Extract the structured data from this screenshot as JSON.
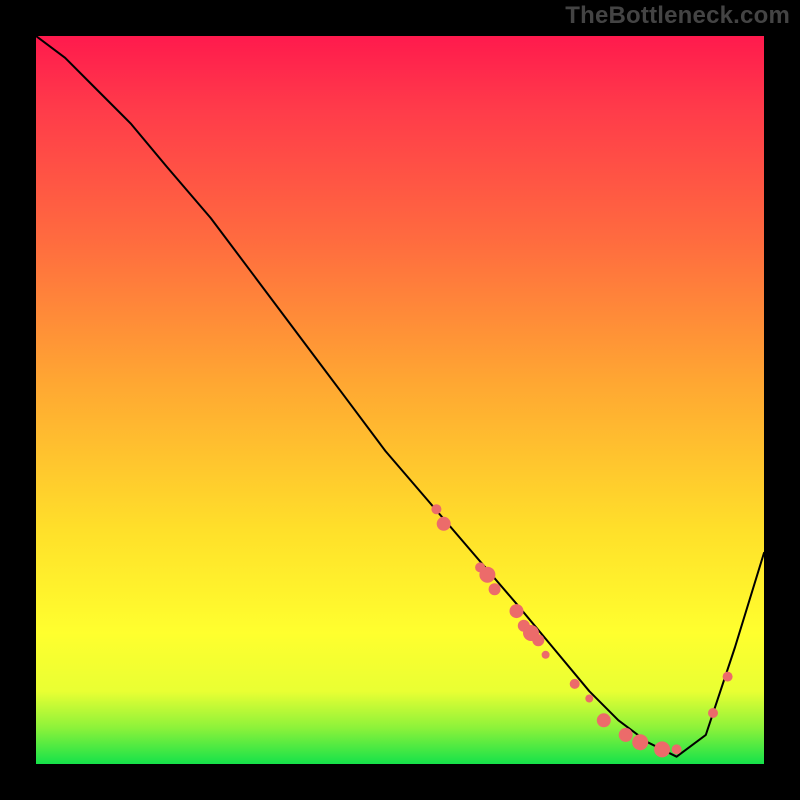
{
  "watermark": "TheBottleneck.com",
  "colors": {
    "background": "#000000",
    "gradient_top": "#ff1a4d",
    "gradient_mid": "#ffe02a",
    "gradient_bottom": "#15e24a",
    "curve": "#000000",
    "points": "#ec6b6a"
  },
  "chart_data": {
    "type": "line",
    "title": "",
    "xlabel": "",
    "ylabel": "",
    "xlim": [
      0,
      100
    ],
    "ylim": [
      0,
      100
    ],
    "grid": false,
    "legend": false,
    "annotations": [],
    "series": [
      {
        "name": "curve",
        "x": [
          0,
          4,
          8,
          13,
          18,
          24,
          30,
          36,
          42,
          48,
          54,
          60,
          66,
          71,
          76,
          80,
          84,
          88,
          92,
          96,
          100
        ],
        "y": [
          100,
          97,
          93,
          88,
          82,
          75,
          67,
          59,
          51,
          43,
          36,
          29,
          22,
          16,
          10,
          6,
          3,
          1,
          4,
          16,
          29
        ]
      }
    ],
    "scatter": [
      {
        "x": 55,
        "y": 35,
        "r": 5
      },
      {
        "x": 56,
        "y": 33,
        "r": 7
      },
      {
        "x": 61,
        "y": 27,
        "r": 5
      },
      {
        "x": 62,
        "y": 26,
        "r": 8
      },
      {
        "x": 63,
        "y": 24,
        "r": 6
      },
      {
        "x": 66,
        "y": 21,
        "r": 7
      },
      {
        "x": 67,
        "y": 19,
        "r": 6
      },
      {
        "x": 68,
        "y": 18,
        "r": 8
      },
      {
        "x": 69,
        "y": 17,
        "r": 6
      },
      {
        "x": 70,
        "y": 15,
        "r": 4
      },
      {
        "x": 74,
        "y": 11,
        "r": 5
      },
      {
        "x": 76,
        "y": 9,
        "r": 4
      },
      {
        "x": 78,
        "y": 6,
        "r": 7
      },
      {
        "x": 81,
        "y": 4,
        "r": 7
      },
      {
        "x": 83,
        "y": 3,
        "r": 8
      },
      {
        "x": 86,
        "y": 2,
        "r": 8
      },
      {
        "x": 88,
        "y": 2,
        "r": 5
      },
      {
        "x": 93,
        "y": 7,
        "r": 5
      },
      {
        "x": 95,
        "y": 12,
        "r": 5
      }
    ]
  }
}
